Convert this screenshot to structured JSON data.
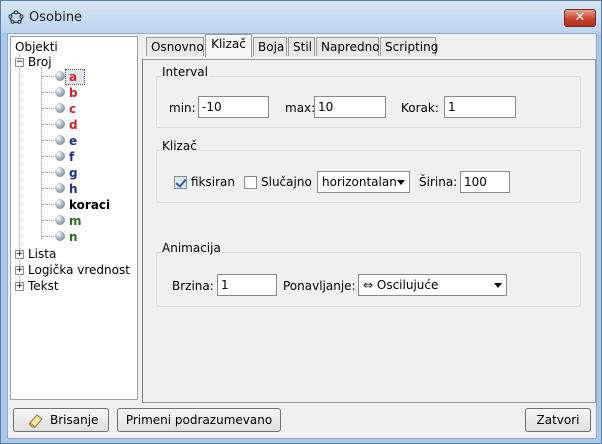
{
  "window": {
    "title": "Osobine",
    "close_icon": "close-icon"
  },
  "tree": {
    "root": "Objekti",
    "groups": [
      {
        "label": "Broj",
        "expanded": true
      },
      {
        "label": "Lista",
        "expanded": false
      },
      {
        "label": "Logička vrednost",
        "expanded": false
      },
      {
        "label": "Tekst",
        "expanded": false
      }
    ],
    "items": [
      {
        "label": "a",
        "color": "#e0202a",
        "selected": true
      },
      {
        "label": "b",
        "color": "#d41f2a"
      },
      {
        "label": "c",
        "color": "#d41f2a"
      },
      {
        "label": "d",
        "color": "#d41f2a"
      },
      {
        "label": "e",
        "color": "#1e2f8e"
      },
      {
        "label": "f",
        "color": "#1e2f8e"
      },
      {
        "label": "g",
        "color": "#1e2f8e"
      },
      {
        "label": "h",
        "color": "#1e2f8e"
      },
      {
        "label": "koraci",
        "color": "#000000"
      },
      {
        "label": "m",
        "color": "#2e6b1e"
      },
      {
        "label": "n",
        "color": "#2e6b1e"
      }
    ]
  },
  "tabs": [
    "Osnovno",
    "Klizač",
    "Boja",
    "Stil",
    "Napredno",
    "Scripting"
  ],
  "active_tab": "Klizač",
  "interval": {
    "title": "Interval",
    "min_label": "min:",
    "min_value": "-10",
    "max_label": "max:",
    "max_value": "10",
    "step_label": "Korak:",
    "step_value": "1"
  },
  "slider": {
    "title": "Klizač",
    "fixed_label": "fiksiran",
    "fixed_checked": true,
    "random_label": "Slučajno",
    "random_checked": false,
    "orientation_value": "horizontalan",
    "width_label": "Širina:",
    "width_value": "100"
  },
  "animation": {
    "title": "Animacija",
    "speed_label": "Brzina:",
    "speed_value": "1",
    "repeat_label": "Ponavljanje:",
    "repeat_value": "⇔ Oscilujuće"
  },
  "footer": {
    "delete_label": "Brisanje",
    "apply_default_label": "Primeni podrazumevano",
    "close_label": "Zatvori"
  }
}
